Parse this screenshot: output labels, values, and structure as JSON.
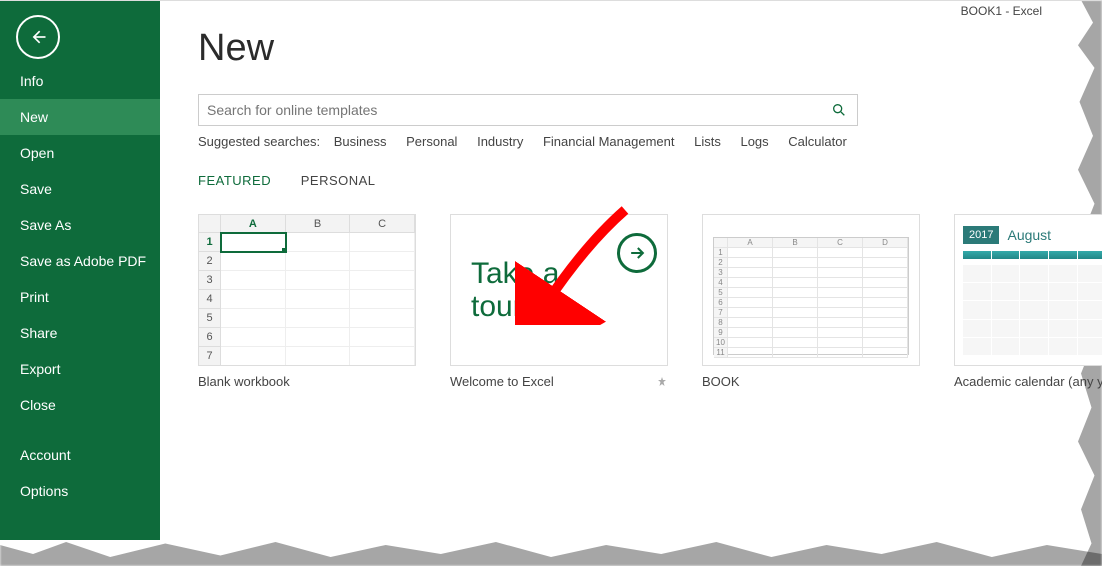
{
  "window_title": "BOOK1 - Excel",
  "sidebar": {
    "items": [
      {
        "label": "Info"
      },
      {
        "label": "New"
      },
      {
        "label": "Open"
      },
      {
        "label": "Save"
      },
      {
        "label": "Save As"
      },
      {
        "label": "Save as Adobe PDF"
      },
      {
        "label": "Print"
      },
      {
        "label": "Share"
      },
      {
        "label": "Export"
      },
      {
        "label": "Close"
      },
      {
        "label": "Account"
      },
      {
        "label": "Options"
      }
    ],
    "active_index": 1
  },
  "page": {
    "title": "New",
    "search_placeholder": "Search for online templates",
    "suggested_label": "Suggested searches:",
    "suggested": [
      "Business",
      "Personal",
      "Industry",
      "Financial Management",
      "Lists",
      "Logs",
      "Calculator"
    ],
    "tabs": [
      "FEATURED",
      "PERSONAL"
    ],
    "active_tab": 0
  },
  "templates": [
    {
      "label": "Blank workbook",
      "kind": "blank"
    },
    {
      "label": "Welcome to Excel",
      "kind": "tour",
      "tour_text": "Take a\ntour",
      "pinnable": true
    },
    {
      "label": "BOOK",
      "kind": "sheet",
      "cols": [
        "A",
        "B",
        "C",
        "D"
      ],
      "rows": 11
    },
    {
      "label": "Academic calendar (any year)",
      "kind": "calendar",
      "year": "2017",
      "month": "August"
    }
  ],
  "blank_grid": {
    "cols": [
      "A",
      "B",
      "C"
    ],
    "rows": [
      1,
      2,
      3,
      4,
      5,
      6,
      7
    ]
  },
  "colors": {
    "accent": "#0e6b3b"
  }
}
